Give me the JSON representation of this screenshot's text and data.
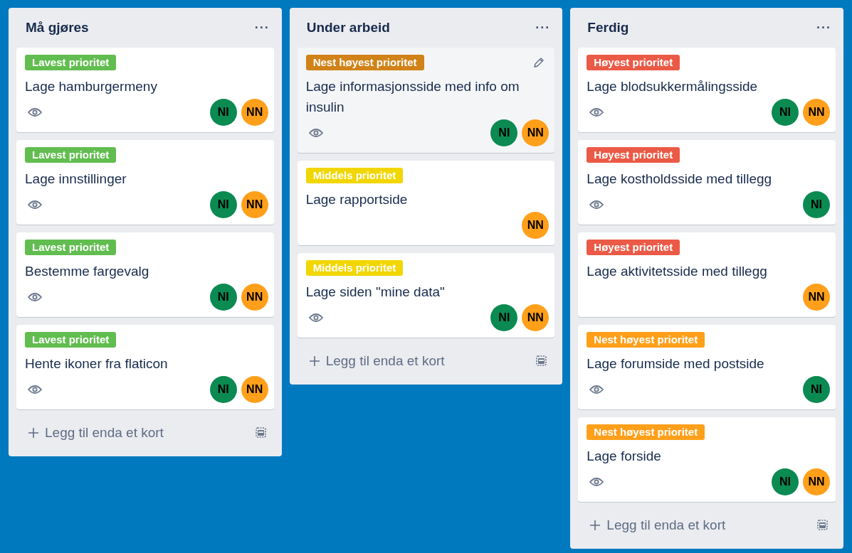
{
  "lists": [
    {
      "title": "Må gjøres",
      "menu": "···",
      "add_card": "Legg til enda et kort",
      "cards": [
        {
          "label": "Lavest prioritet",
          "color": "#61bd4f",
          "title": "Lage hamburgermeny",
          "watching": true,
          "hovered": false,
          "members": [
            {
              "initials": "NI",
              "color": "#0b8a52"
            },
            {
              "initials": "NN",
              "color": "#ff9f1a"
            }
          ]
        },
        {
          "label": "Lavest prioritet",
          "color": "#61bd4f",
          "title": "Lage innstillinger",
          "watching": true,
          "hovered": false,
          "members": [
            {
              "initials": "NI",
              "color": "#0b8a52"
            },
            {
              "initials": "NN",
              "color": "#ff9f1a"
            }
          ]
        },
        {
          "label": "Lavest prioritet",
          "color": "#61bd4f",
          "title": "Bestemme fargevalg",
          "watching": true,
          "hovered": false,
          "members": [
            {
              "initials": "NI",
              "color": "#0b8a52"
            },
            {
              "initials": "NN",
              "color": "#ff9f1a"
            }
          ]
        },
        {
          "label": "Lavest prioritet",
          "color": "#61bd4f",
          "title": "Hente ikoner fra flaticon",
          "watching": true,
          "hovered": false,
          "members": [
            {
              "initials": "NI",
              "color": "#0b8a52"
            },
            {
              "initials": "NN",
              "color": "#ff9f1a"
            }
          ]
        }
      ]
    },
    {
      "title": "Under arbeid",
      "menu": "···",
      "add_card": "Legg til enda et kort",
      "cards": [
        {
          "label": "Nest høyest prioritet",
          "color": "#d18218",
          "title": "Lage informasjonsside med info om insulin",
          "watching": true,
          "hovered": true,
          "members": [
            {
              "initials": "NI",
              "color": "#0b8a52"
            },
            {
              "initials": "NN",
              "color": "#ff9f1a"
            }
          ]
        },
        {
          "label": "Middels prioritet",
          "color": "#f2d600",
          "title": "Lage rapportside",
          "watching": false,
          "hovered": false,
          "members": [
            {
              "initials": "NN",
              "color": "#ff9f1a"
            }
          ]
        },
        {
          "label": "Middels prioritet",
          "color": "#f2d600",
          "title": "Lage siden \"mine data\"",
          "watching": true,
          "hovered": false,
          "members": [
            {
              "initials": "NI",
              "color": "#0b8a52"
            },
            {
              "initials": "NN",
              "color": "#ff9f1a"
            }
          ]
        }
      ]
    },
    {
      "title": "Ferdig",
      "menu": "···",
      "add_card": "Legg til enda et kort",
      "cards": [
        {
          "label": "Høyest prioritet",
          "color": "#eb5a46",
          "title": "Lage blodsukkermålingsside",
          "watching": true,
          "hovered": false,
          "members": [
            {
              "initials": "NI",
              "color": "#0b8a52"
            },
            {
              "initials": "NN",
              "color": "#ff9f1a"
            }
          ]
        },
        {
          "label": "Høyest prioritet",
          "color": "#eb5a46",
          "title": "Lage kostholdsside med tillegg",
          "watching": true,
          "hovered": false,
          "members": [
            {
              "initials": "NI",
              "color": "#0b8a52"
            }
          ]
        },
        {
          "label": "Høyest prioritet",
          "color": "#eb5a46",
          "title": "Lage aktivitetsside med tillegg",
          "watching": false,
          "hovered": false,
          "members": [
            {
              "initials": "NN",
              "color": "#ff9f1a"
            }
          ]
        },
        {
          "label": "Nest høyest prioritet",
          "color": "#ff9f1a",
          "title": "Lage forumside med postside",
          "watching": true,
          "hovered": false,
          "members": [
            {
              "initials": "NI",
              "color": "#0b8a52"
            }
          ]
        },
        {
          "label": "Nest høyest prioritet",
          "color": "#ff9f1a",
          "title": "Lage forside",
          "watching": true,
          "hovered": false,
          "members": [
            {
              "initials": "NI",
              "color": "#0b8a52"
            },
            {
              "initials": "NN",
              "color": "#ff9f1a"
            }
          ]
        }
      ]
    }
  ]
}
